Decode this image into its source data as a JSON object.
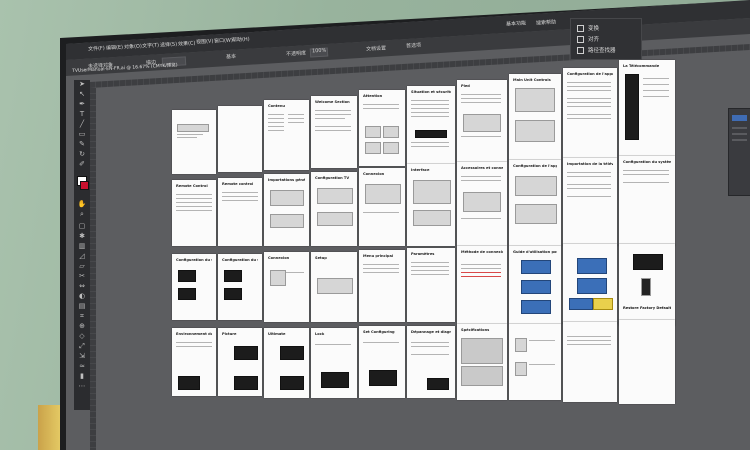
{
  "menubar": {
    "items": [
      "文件(F)",
      "编辑(E)",
      "对象(O)",
      "文字(T)",
      "选择(S)",
      "效果(C)",
      "视图(V)",
      "窗口(W)",
      "帮助(H)"
    ],
    "right_items": [
      "基本功能",
      "搜索帮助"
    ]
  },
  "options_bar": {
    "items": [
      "未选择对象",
      "描边",
      "基本",
      "不透明度",
      "100%",
      "文档设置",
      "首选项"
    ]
  },
  "document_tab": "TVUserManual-EN-FR.ai @ 16.67% (CMYK/预览)",
  "floating_menu": {
    "items": [
      {
        "icon": "transform-icon",
        "label": "变换"
      },
      {
        "icon": "align-icon",
        "label": "对齐"
      },
      {
        "icon": "pathfinder-icon",
        "label": "路径查找器"
      }
    ]
  },
  "artboards": {
    "row1": [
      {
        "title": ""
      },
      {
        "title": ""
      },
      {
        "title": "Contenu"
      },
      {
        "title": "Welcome Section"
      },
      {
        "title": "Attention"
      },
      {
        "title": "Situation et sécurités"
      },
      {
        "title": "Pied"
      },
      {
        "title": "Main Unit Controls"
      },
      {
        "title": "Configuration de l'appareil"
      },
      {
        "title": "La Télécommande"
      }
    ],
    "row2": [
      {
        "title": "Remote Control"
      },
      {
        "title": "Remote control"
      },
      {
        "title": "Importations générales"
      },
      {
        "title": "Configuration TV"
      },
      {
        "title": "Connexion"
      },
      {
        "title": "Interface"
      },
      {
        "title": "Accessoires et connexions"
      },
      {
        "title": "Configuration de l'appareil"
      },
      {
        "title": "Importation de la télévision"
      },
      {
        "title": "Configuration du système"
      }
    ],
    "row3": [
      {
        "title": "Configuration du système"
      },
      {
        "title": "Configuration du système"
      },
      {
        "title": "Connexion"
      },
      {
        "title": "Setup"
      },
      {
        "title": "Menu principal"
      },
      {
        "title": "Paramètres"
      },
      {
        "title": "Méthode de connexion à la télévision"
      },
      {
        "title": "Guide d'utilisation pour le contenu TV"
      },
      {
        "title": ""
      },
      {
        "title": "Restore Factory Default"
      }
    ],
    "row4": [
      {
        "title": "Environnement du menu TV"
      },
      {
        "title": "Picture"
      },
      {
        "title": "Ultimate"
      },
      {
        "title": "Lock"
      },
      {
        "title": "Set Configuring"
      },
      {
        "title": "Dépannage et diagnostic"
      },
      {
        "title": "Spécifications"
      },
      {
        "title": ""
      },
      {
        "title": ""
      },
      {
        "title": ""
      }
    ]
  },
  "colors": {
    "screen": "#5c5d60",
    "ui_dark": "#2f3033",
    "accent_blue": "#3f6cb4",
    "stroke_swatch": "#c8102e"
  }
}
